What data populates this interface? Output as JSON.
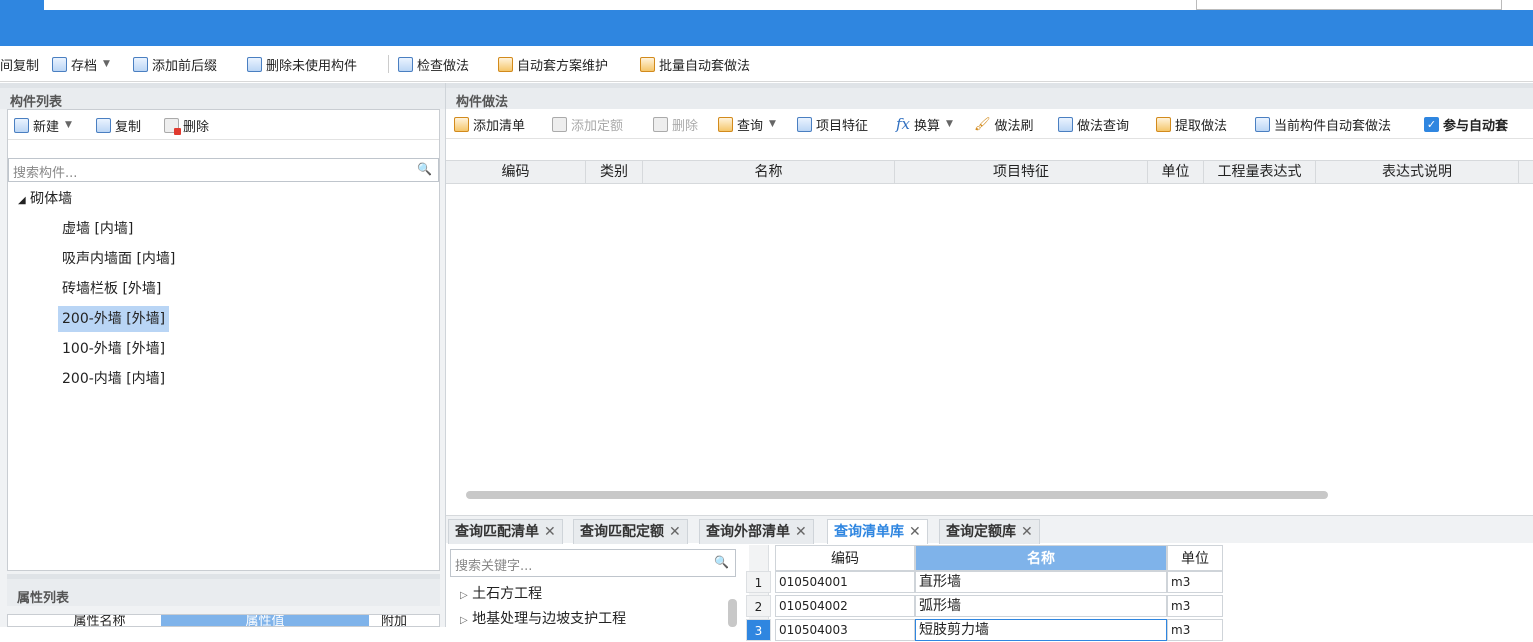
{
  "toolbar": {
    "items": [
      {
        "label": "间复制",
        "icon": "copy-icon"
      },
      {
        "label": "存档",
        "icon": "archive-icon",
        "caret": true
      },
      {
        "label": "添加前后缀",
        "icon": "add-prefix-icon"
      },
      {
        "label": "删除未使用构件",
        "icon": "delete-unused-icon"
      },
      {
        "label": "检查做法",
        "icon": "check-icon"
      },
      {
        "label": "自动套方案维护",
        "icon": "auto-apply-icon"
      },
      {
        "label": "批量自动套做法",
        "icon": "batch-apply-icon"
      }
    ]
  },
  "left": {
    "title": "构件列表",
    "new_label": "新建",
    "copy_label": "复制",
    "delete_label": "删除",
    "search_placeholder": "搜索构件...",
    "tree_root": "砌体墙",
    "tree_items": [
      "虚墙 [内墙]",
      "吸声内墙面 [内墙]",
      "砖墙栏板 [外墙]",
      "200-外墙 [外墙]",
      "100-外墙 [外墙]",
      "200-内墙 [内墙]"
    ],
    "selected_index": 3,
    "props_title": "属性列表",
    "props_headers": [
      "属性名称",
      "属性值",
      "附加"
    ]
  },
  "right": {
    "title": "构件做法",
    "tools": [
      {
        "label": "添加清单",
        "icon": "add-list-icon",
        "enabled": true
      },
      {
        "label": "添加定额",
        "icon": "add-quota-icon",
        "enabled": false
      },
      {
        "label": "删除",
        "icon": "delete-icon",
        "enabled": false
      },
      {
        "label": "查询",
        "icon": "query-icon",
        "enabled": true,
        "caret": true
      },
      {
        "label": "项目特征",
        "icon": "feature-icon",
        "enabled": true
      },
      {
        "label": "换算",
        "icon": "fx-icon",
        "enabled": true,
        "caret": true
      },
      {
        "label": "做法刷",
        "icon": "brush-icon",
        "enabled": true
      },
      {
        "label": "做法查询",
        "icon": "method-query-icon",
        "enabled": true
      },
      {
        "label": "提取做法",
        "icon": "extract-icon",
        "enabled": true
      },
      {
        "label": "当前构件自动套做法",
        "icon": "current-auto-icon",
        "enabled": true
      },
      {
        "label": "参与自动套",
        "icon": "checkbox-icon",
        "enabled": true,
        "checked": true
      }
    ],
    "columns": [
      "编码",
      "类别",
      "名称",
      "项目特征",
      "单位",
      "工程量表达式",
      "表达式说明"
    ],
    "bottom_tabs": [
      {
        "label": "查询匹配清单",
        "active": false
      },
      {
        "label": "查询匹配定额",
        "active": false
      },
      {
        "label": "查询外部清单",
        "active": false
      },
      {
        "label": "查询清单库",
        "active": true
      },
      {
        "label": "查询定额库",
        "active": false
      }
    ],
    "lib_search_placeholder": "搜索关键字...",
    "lib_tree": [
      "土石方工程",
      "地基处理与边坡支护工程"
    ],
    "lib_columns": [
      "编码",
      "名称",
      "单位"
    ],
    "lib_rows": [
      {
        "num": "1",
        "code": "010504001",
        "name": "直形墙",
        "unit": "m3"
      },
      {
        "num": "2",
        "code": "010504002",
        "name": "弧形墙",
        "unit": "m3"
      },
      {
        "num": "3",
        "code": "010504003",
        "name": "短肢剪力墙",
        "unit": "m3"
      }
    ]
  },
  "colors": {
    "accent": "#2f86e0",
    "selection": "#b9d5f5"
  }
}
